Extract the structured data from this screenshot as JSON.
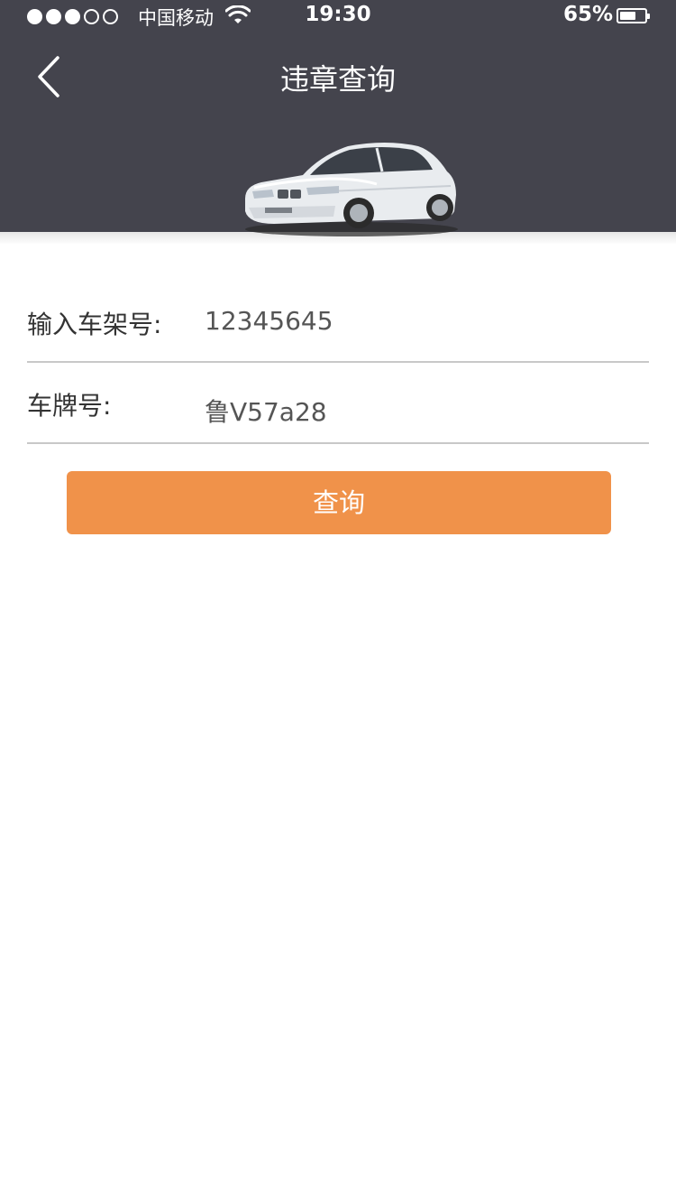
{
  "status_bar": {
    "signal_dots": [
      true,
      true,
      true,
      false,
      false
    ],
    "carrier": "中国移动",
    "wifi_icon": "wifi-icon",
    "time": "19:30",
    "battery_percent": "65%",
    "battery_level": 0.65
  },
  "nav": {
    "back_icon": "chevron-left-icon",
    "title": "违章查询"
  },
  "hero": {
    "image": "white-sedan-car"
  },
  "form": {
    "vin_label": "输入车架号:",
    "vin_value": "12345645",
    "plate_label": "车牌号:",
    "plate_value": "鲁V57a28"
  },
  "actions": {
    "query_label": "查询"
  },
  "colors": {
    "header_bg": "#44444d",
    "accent": "#f0924a",
    "divider": "#c8c8c8"
  }
}
